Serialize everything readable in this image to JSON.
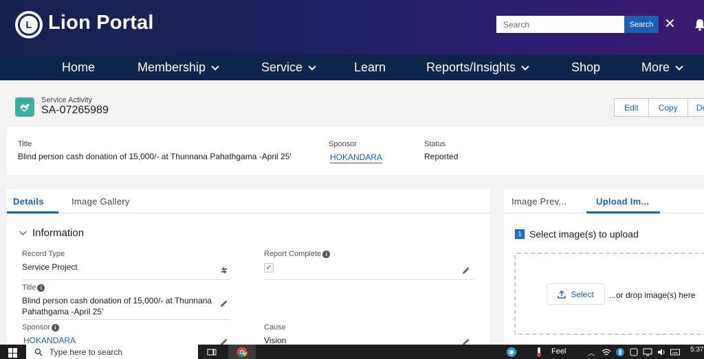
{
  "header": {
    "brand": "Lion Portal",
    "search_placeholder": "Search",
    "search_button": "Search",
    "close_symbol": "✕"
  },
  "nav": {
    "items": [
      {
        "label": "Home",
        "dropdown": false
      },
      {
        "label": "Membership",
        "dropdown": true
      },
      {
        "label": "Service",
        "dropdown": true
      },
      {
        "label": "Learn",
        "dropdown": false
      },
      {
        "label": "Reports/Insights",
        "dropdown": true
      },
      {
        "label": "Shop",
        "dropdown": false
      },
      {
        "label": "More",
        "dropdown": true
      }
    ]
  },
  "record": {
    "object_type": "Service Activity",
    "id": "SA-07265989",
    "actions": [
      "Edit",
      "Copy",
      "De"
    ]
  },
  "highlights": {
    "title_label": "Title",
    "title_value": "Blind person cash donation of 15,000/- at Thunnana Pahathgama -April 25'",
    "sponsor_label": "Sponsor",
    "sponsor_value": "HOKANDARA",
    "status_label": "Status",
    "status_value": "Reported"
  },
  "main_tabs": {
    "details": "Details",
    "gallery": "Image Gallery"
  },
  "information": {
    "section_title": "Information",
    "record_type_label": "Record Type",
    "record_type_value": "Service Project",
    "report_complete_label": "Report Complete",
    "report_complete_checked": true,
    "title_label": "Title",
    "title_value_line1": "Blind person cash donation of 15,000/- at Thunnana",
    "title_value_line2": "Pahathgama -April 25'",
    "sponsor_label": "Sponsor",
    "sponsor_value": "HOKANDARA",
    "cause_label": "Cause",
    "cause_value": "Vision"
  },
  "right_panel": {
    "tab_preview": "Image Prev...",
    "tab_upload": "Upload Im...",
    "step_number": "1",
    "step_text": "Select image(s) to upload",
    "select_button": "Select",
    "drop_text": "...or drop image(s) here"
  },
  "taskbar": {
    "search_placeholder": "Type here to search",
    "weather": "Feel",
    "time": "5:37"
  },
  "colors": {
    "accent": "#1b5fb5",
    "nav_bg": "#0c254a",
    "record_icon": "#3bb0a2"
  }
}
